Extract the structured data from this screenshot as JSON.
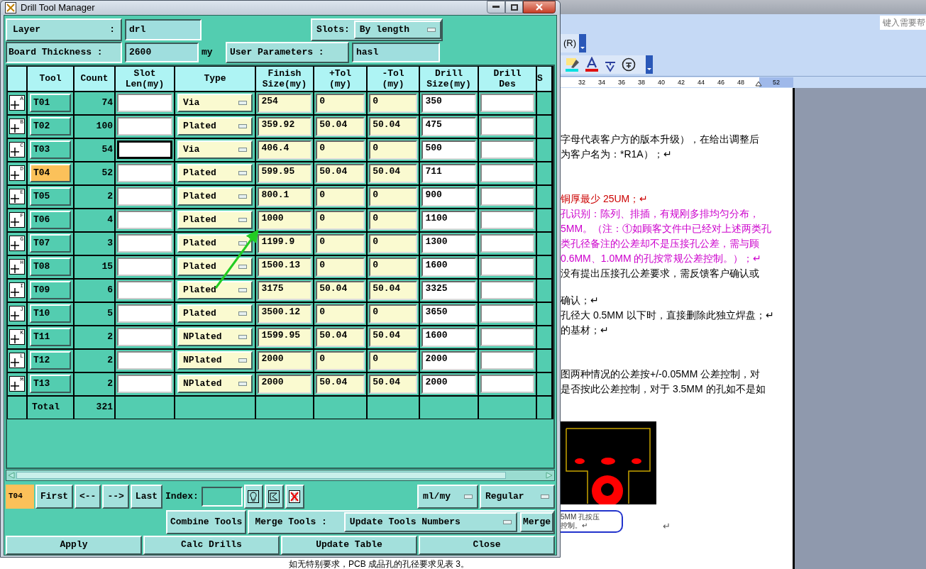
{
  "window": {
    "title": "Drill Tool Manager"
  },
  "layer": {
    "label": "Layer",
    "separator": ":",
    "value": "drl"
  },
  "slots": {
    "label": "Slots:",
    "value": "By length"
  },
  "board_thickness": {
    "label": "Board Thickness :",
    "value": "2600",
    "unit": "my"
  },
  "user_parameters": {
    "label": "User Parameters :",
    "value": "hasl"
  },
  "table": {
    "columns": [
      "Tool",
      "Count",
      "Slot Len(my)",
      "Type",
      "Finish Size(my)",
      "+Tol (my)",
      "-Tol (my)",
      "Drill Size(my)",
      "Drill Des",
      "S"
    ],
    "rows": [
      {
        "mark": "A",
        "tool": "T01",
        "selected": false,
        "count": "74",
        "focused": false,
        "type": "Via",
        "finish": "254",
        "plus_tol": "0",
        "minus_tol": "0",
        "drill_size": "350"
      },
      {
        "mark": "B",
        "tool": "T02",
        "selected": false,
        "count": "100",
        "focused": false,
        "type": "Plated",
        "finish": "359.92",
        "plus_tol": "50.04",
        "minus_tol": "50.04",
        "drill_size": "475"
      },
      {
        "mark": "C",
        "tool": "T03",
        "selected": false,
        "count": "54",
        "focused": true,
        "type": "Via",
        "finish": "406.4",
        "plus_tol": "0",
        "minus_tol": "0",
        "drill_size": "500"
      },
      {
        "mark": "D",
        "tool": "T04",
        "selected": true,
        "count": "52",
        "focused": false,
        "type": "Plated",
        "finish": "599.95",
        "plus_tol": "50.04",
        "minus_tol": "50.04",
        "drill_size": "711"
      },
      {
        "mark": "E",
        "tool": "T05",
        "selected": false,
        "count": "2",
        "focused": false,
        "type": "Plated",
        "finish": "800.1",
        "plus_tol": "0",
        "minus_tol": "0",
        "drill_size": "900"
      },
      {
        "mark": "F",
        "tool": "T06",
        "selected": false,
        "count": "4",
        "focused": false,
        "type": "Plated",
        "finish": "1000",
        "plus_tol": "0",
        "minus_tol": "0",
        "drill_size": "1100"
      },
      {
        "mark": "G",
        "tool": "T07",
        "selected": false,
        "count": "3",
        "focused": false,
        "type": "Plated",
        "finish": "1199.9",
        "plus_tol": "0",
        "minus_tol": "0",
        "drill_size": "1300"
      },
      {
        "mark": "H",
        "tool": "T08",
        "selected": false,
        "count": "15",
        "focused": false,
        "type": "Plated",
        "finish": "1500.13",
        "plus_tol": "0",
        "minus_tol": "0",
        "drill_size": "1600"
      },
      {
        "mark": "I",
        "tool": "T09",
        "selected": false,
        "count": "6",
        "focused": false,
        "type": "Plated",
        "finish": "3175",
        "plus_tol": "50.04",
        "minus_tol": "50.04",
        "drill_size": "3325"
      },
      {
        "mark": "J",
        "tool": "T10",
        "selected": false,
        "count": "5",
        "focused": false,
        "type": "Plated",
        "finish": "3500.12",
        "plus_tol": "0",
        "minus_tol": "0",
        "drill_size": "3650"
      },
      {
        "mark": "K",
        "tool": "T11",
        "selected": false,
        "count": "2",
        "focused": false,
        "type": "NPlated",
        "finish": "1599.95",
        "plus_tol": "50.04",
        "minus_tol": "50.04",
        "drill_size": "1600"
      },
      {
        "mark": "L",
        "tool": "T12",
        "selected": false,
        "count": "2",
        "focused": false,
        "type": "NPlated",
        "finish": "2000",
        "plus_tol": "0",
        "minus_tol": "0",
        "drill_size": "2000"
      },
      {
        "mark": "M",
        "tool": "T13",
        "selected": false,
        "count": "2",
        "focused": false,
        "type": "NPlated",
        "finish": "2000",
        "plus_tol": "50.04",
        "minus_tol": "50.04",
        "drill_size": "2000"
      }
    ],
    "total": {
      "label": "Total",
      "count": "321"
    }
  },
  "navigation": {
    "current_tool": "T04",
    "buttons": [
      "First",
      "<--",
      "-->",
      "Last"
    ],
    "index_label": "Index:",
    "units": "ml/my",
    "mode": "Regular"
  },
  "merge": {
    "combine": "Combine Tools",
    "label": "Merge Tools :",
    "option": "Update Tools Numbers",
    "merge": "Merge"
  },
  "buttons": [
    "Apply",
    "Calc Drills",
    "Update Table",
    "Close"
  ],
  "background_document": {
    "help_box": "键入需要帮",
    "menu_fragment": "(R)",
    "ruler": [
      "32",
      "34",
      "36",
      "38",
      "40",
      "42",
      "44",
      "46",
      "48",
      "52"
    ],
    "lines": [
      {
        "text": "字母代表客户方的版本升级），在给出调整后",
        "color": "#000000"
      },
      {
        "text": "为客户名为：*R1A）；↵",
        "color": "#000000"
      },
      {
        "text": "铜厚最少 25UM；↵",
        "color": "#cc0000"
      },
      {
        "text": "孔识别：陈列、排插，有规刚多排均匀分布，",
        "color": "#cc00cc"
      },
      {
        "text": "5MM。（注：①如顾客文件中已经对上述两类孔",
        "color": "#cc00cc"
      },
      {
        "text": "类孔径备注的公差却不是压接孔公差，需与顾",
        "color": "#cc00cc"
      },
      {
        "text": "0.6MM、1.0MM 的孔按常规公差控制。）；↵",
        "color": "#cc00cc"
      },
      {
        "text": "没有提出压接孔公差要求，需反馈客户确认或",
        "color": "#000000"
      },
      {
        "text": "确认；↵",
        "color": "#000000"
      },
      {
        "text": "孔径大 0.5MM 以下时，直接删除此独立焊盘；↵",
        "color": "#000000"
      },
      {
        "text": "的基材；↵",
        "color": "#000000"
      },
      {
        "text": "图两种情况的公差按+/-0.05MM 公差控制，对",
        "color": "#000000"
      },
      {
        "text": "是否按此公差控制，对于 3.5MM 的孔如不是如",
        "color": "#000000"
      }
    ],
    "callout": [
      "5MM 孔按压",
      "控制。↵"
    ],
    "paragraph_mark": "↵",
    "bottom_line": "如无特别要求，PCB 成品孔的孔径要求见表 3。"
  }
}
